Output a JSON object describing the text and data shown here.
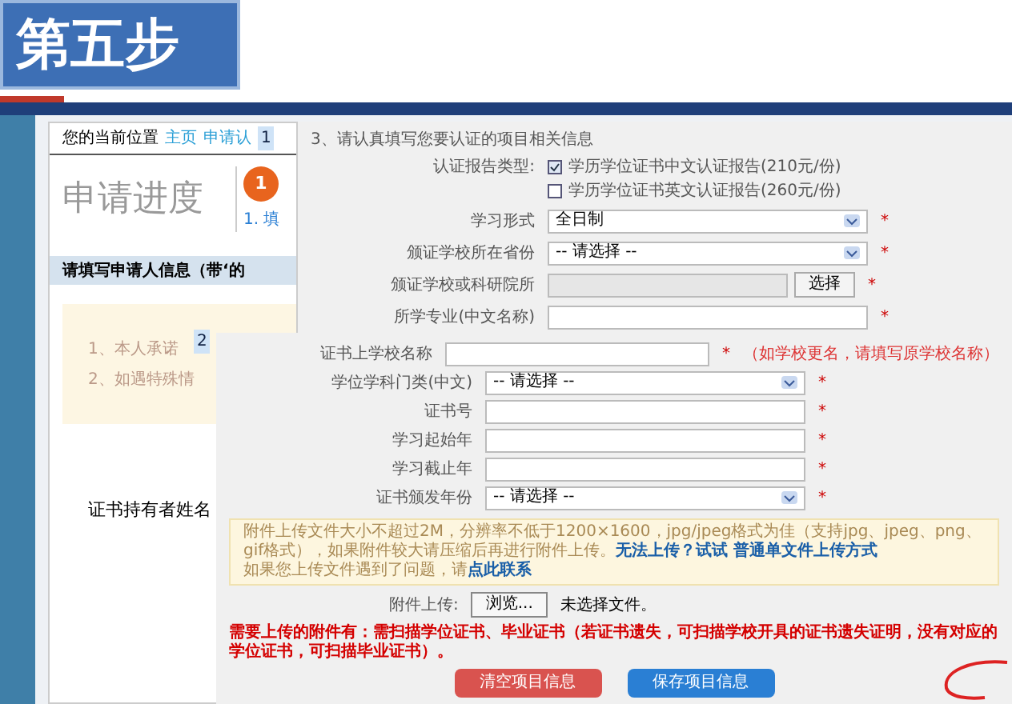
{
  "banner": {
    "title": "第五步"
  },
  "breadcrumb": {
    "label": "您的当前位置",
    "links": [
      "主页",
      "申请认"
    ]
  },
  "progress": {
    "title": "申请进度",
    "step": "1",
    "step_label": "1. 填"
  },
  "section_title": "请填写申请人信息（带‘的",
  "notices": [
    "1、本人承诺",
    "2、如遇特殊情"
  ],
  "holder_label": "证书持有者姓名",
  "markers": [
    "1",
    "2"
  ],
  "form": {
    "heading": "3、请认真填写您要认证的项目相关信息",
    "report_type": {
      "label": "认证报告类型:",
      "options": [
        {
          "label": "学历学位证书中文认证报告(210元/份)",
          "checked": true
        },
        {
          "label": "学历学位证书英文认证报告(260元/份)",
          "checked": false
        }
      ]
    },
    "project_fields": [
      {
        "kind": "select",
        "label": "学习形式",
        "value": "全日制",
        "mark": "*"
      },
      {
        "kind": "select",
        "label": "颁证学校所在省份",
        "value": "-- 请选择 --",
        "mark": "*"
      },
      {
        "kind": "picker",
        "label": "颁证学校或科研院所",
        "button": "选择",
        "mark": "*"
      },
      {
        "kind": "input",
        "label": "所学专业(中文名称)",
        "mark": "*"
      }
    ],
    "certificate_fields": [
      {
        "kind": "input",
        "label": "证书上学校名称",
        "mark": "*",
        "hint": "（如学校更名，请填写原学校名称）"
      },
      {
        "kind": "select",
        "label": "学位学科门类(中文)",
        "value": "-- 请选择 --",
        "mark": "*"
      },
      {
        "kind": "input",
        "label": "证书号",
        "mark": "*"
      },
      {
        "kind": "input",
        "label": "学习起始年",
        "mark": "*"
      },
      {
        "kind": "input",
        "label": "学习截止年",
        "mark": "*"
      },
      {
        "kind": "select",
        "label": "证书颁发年份",
        "value": "-- 请选择 --",
        "mark": "*"
      }
    ],
    "upload_notes": [
      {
        "text": "附件上传文件大小不超过2M，分辨率不低于1200×1600，jpg/jpeg格式为佳（支持jpg、jpeg、png、gif格式），如果附件较大请压缩后再进行附件上传。",
        "link": "无法上传？试试 普通单文件上传方式"
      },
      {
        "text": "如果您上传文件遇到了问题，请",
        "link": "点此联系"
      }
    ],
    "upload": {
      "label": "附件上传:",
      "button": "浏览...",
      "status": "未选择文件。"
    },
    "requirement": "需要上传的附件有：需扫描学位证书、毕业证书（若证书遗失，可扫描学校开具的证书遗失证明，没有对应的学位证书，可扫描毕业证书）。",
    "buttons": [
      {
        "label": "清空项目信息",
        "color": "#d9534f"
      },
      {
        "label": "保存项目信息",
        "color": "#2a7fd4"
      }
    ]
  }
}
